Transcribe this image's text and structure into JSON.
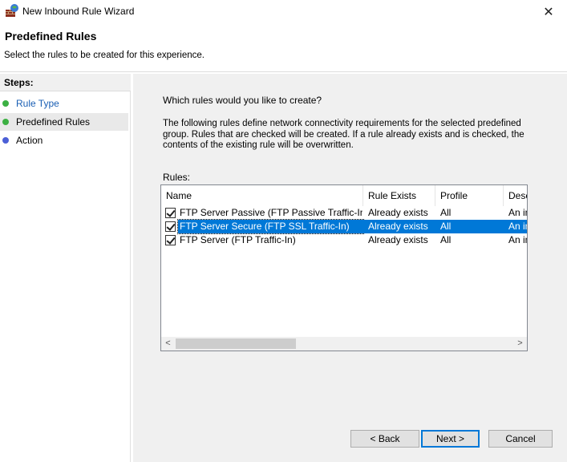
{
  "window": {
    "title": "New Inbound Rule Wizard",
    "close_glyph": "✕"
  },
  "header": {
    "title": "Predefined Rules",
    "subtitle": "Select the rules to be created for this experience."
  },
  "steps": {
    "title": "Steps:",
    "items": [
      {
        "label": "Rule Type",
        "dot_color": "#3cb043",
        "link": true
      },
      {
        "label": "Predefined Rules",
        "dot_color": "#3cb043",
        "link": false
      },
      {
        "label": "Action",
        "dot_color": "#4b5fd6",
        "link": false
      }
    ]
  },
  "content": {
    "question": "Which rules would you like to create?",
    "description": "The following rules define network connectivity requirements for the selected predefined group. Rules that are checked will be created. If a rule already exists and is checked, the contents of the existing rule will be overwritten.",
    "rules_label": "Rules:"
  },
  "table": {
    "columns": [
      "Name",
      "Rule Exists",
      "Profile",
      "Desc"
    ],
    "rows": [
      {
        "checked": true,
        "name": "FTP Server Passive (FTP Passive Traffic-In)",
        "exists": "Already exists",
        "profile": "All",
        "desc": "An in"
      },
      {
        "checked": true,
        "name": "FTP Server Secure (FTP SSL Traffic-In)",
        "exists": "Already exists",
        "profile": "All",
        "desc": "An in",
        "selected": true
      },
      {
        "checked": true,
        "name": "FTP Server (FTP Traffic-In)",
        "exists": "Already exists",
        "profile": "All",
        "desc": "An in"
      }
    ],
    "scroll_left": "<",
    "scroll_right": ">"
  },
  "buttons": {
    "back": "< Back",
    "next": "Next >",
    "cancel": "Cancel"
  },
  "colors": {
    "selection": "#0078d7",
    "step_done": "#3cb043",
    "step_pending": "#4b5fd6"
  }
}
